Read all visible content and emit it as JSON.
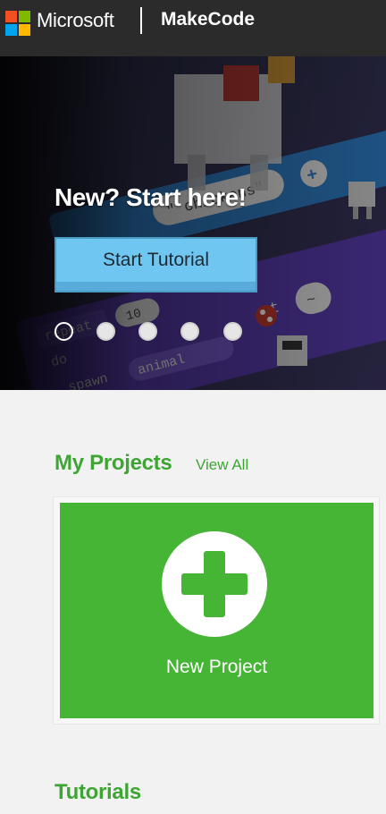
{
  "header": {
    "brand": "Microsoft",
    "app_name": "MakeCode",
    "logo_colors": [
      "#f25022",
      "#7fba00",
      "#00a4ef",
      "#ffb900"
    ]
  },
  "hero": {
    "title": "New? Start here!",
    "button_label": "Start Tutorial",
    "background_icon": "minecraft-code-blocks-chicken-art",
    "code_snippets": [
      "\" chickens\"",
      "repeat",
      "10",
      "do",
      "spawn",
      "animal",
      "at",
      "~"
    ],
    "carousel": {
      "slide_count": 5,
      "active_index": 0
    }
  },
  "my_projects": {
    "title": "My Projects",
    "view_all": "View All",
    "new_project": {
      "label": "New Project",
      "icon": "plus-icon",
      "color": "#46b535"
    }
  },
  "tutorials": {
    "title": "Tutorials"
  },
  "colors": {
    "accent_green": "#3ea534",
    "button_blue": "#6fc6f0",
    "header_bg": "#2b2b2b"
  }
}
